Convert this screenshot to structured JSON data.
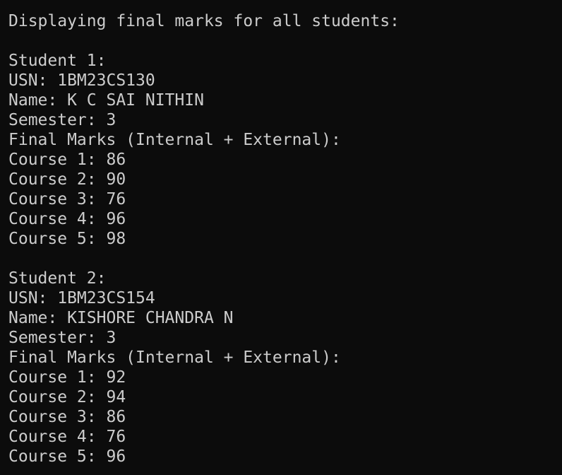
{
  "header": "Displaying final marks for all students:",
  "students": [
    {
      "heading": "Student 1:",
      "usn": "USN: 1BM23CS130",
      "name": "Name: K C SAI NITHIN",
      "semester": "Semester: 3",
      "marks_title": "Final Marks (Internal + External):",
      "courses": [
        "Course 1: 86",
        "Course 2: 90",
        "Course 3: 76",
        "Course 4: 96",
        "Course 5: 98"
      ]
    },
    {
      "heading": "Student 2:",
      "usn": "USN: 1BM23CS154",
      "name": "Name: KISHORE CHANDRA N",
      "semester": "Semester: 3",
      "marks_title": "Final Marks (Internal + External):",
      "courses": [
        "Course 1: 92",
        "Course 2: 94",
        "Course 3: 86",
        "Course 4: 76",
        "Course 5: 96"
      ]
    }
  ],
  "colors": {
    "background": "#0c0c0c",
    "text": "#cccccc"
  }
}
